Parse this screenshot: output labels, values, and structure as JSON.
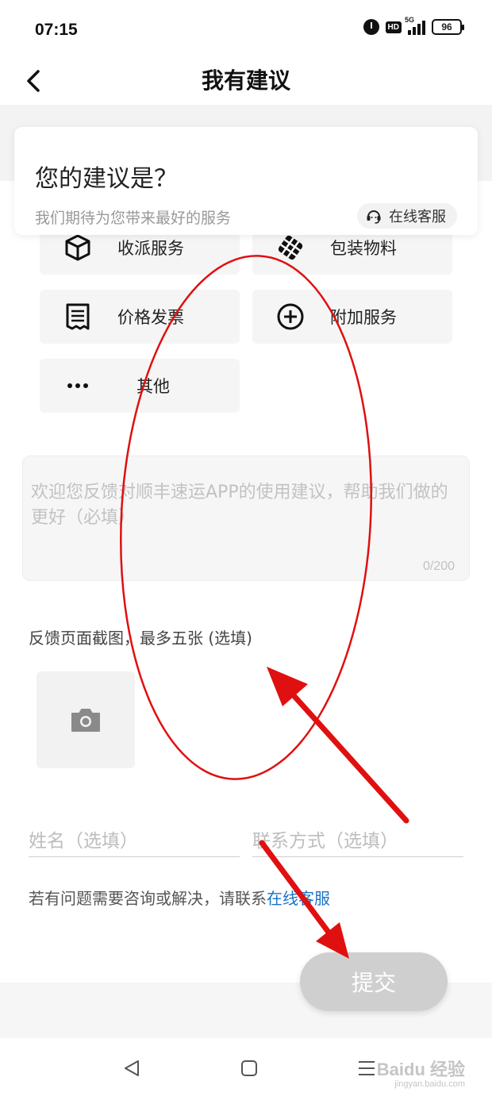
{
  "status_bar": {
    "time": "07:15",
    "network": "5G",
    "hd": "HD",
    "battery": "96"
  },
  "header": {
    "title": "我有建议",
    "back_icon": "chevron-left-icon"
  },
  "intro_card": {
    "title": "您的建议是？",
    "subtitle": "我们期待为您带来最好的服务",
    "service_button": "在线客服",
    "service_icon": "headset-icon"
  },
  "categories": [
    {
      "label": "收派服务",
      "icon": "package-box-icon"
    },
    {
      "label": "包装物料",
      "icon": "grid-cube-icon"
    },
    {
      "label": "价格发票",
      "icon": "receipt-icon"
    },
    {
      "label": "附加服务",
      "icon": "plus-circle-icon"
    },
    {
      "label": "其他",
      "icon": "more-dots-icon"
    }
  ],
  "feedback": {
    "placeholder": "欢迎您反馈对顺丰速运APP的使用建议，帮助我们做的更好（必填）",
    "counter": "0/200"
  },
  "screenshots": {
    "label": "反馈页面截图，最多五张 (选填)",
    "upload_icon": "camera-icon"
  },
  "form": {
    "name_placeholder": "姓名（选填）",
    "contact_placeholder": "联系方式（选填）"
  },
  "help": {
    "text": "若有问题需要咨询或解决，请联系",
    "link": "在线客服"
  },
  "submit_label": "提交",
  "watermark": {
    "text": "Baidu 经验",
    "sub": "jingyan.baidu.com"
  },
  "colors": {
    "link": "#1a73c8",
    "annotation": "#e01010",
    "submit_disabled": "#cfcfcf"
  }
}
